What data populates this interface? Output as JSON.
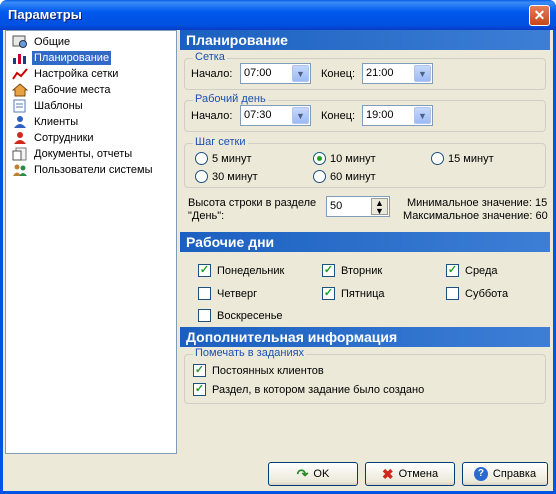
{
  "window": {
    "title": "Параметры",
    "close_glyph": "✕"
  },
  "tree": {
    "items": [
      {
        "label": "Общие",
        "icon": "general-icon"
      },
      {
        "label": "Планирование",
        "icon": "planning-icon",
        "selected": true
      },
      {
        "label": "Настройка сетки",
        "icon": "grid-settings-icon"
      },
      {
        "label": "Рабочие места",
        "icon": "workplaces-icon"
      },
      {
        "label": "Шаблоны",
        "icon": "templates-icon"
      },
      {
        "label": "Клиенты",
        "icon": "clients-icon"
      },
      {
        "label": "Сотрудники",
        "icon": "employees-icon"
      },
      {
        "label": "Документы, отчеты",
        "icon": "documents-icon"
      },
      {
        "label": "Пользователи системы",
        "icon": "users-icon"
      }
    ]
  },
  "planning": {
    "header": "Планирование",
    "grid": {
      "title": "Сетка",
      "start_label": "Начало:",
      "start_value": "07:00",
      "end_label": "Конец:",
      "end_value": "21:00"
    },
    "workday": {
      "title": "Рабочий день",
      "start_label": "Начало:",
      "start_value": "07:30",
      "end_label": "Конец:",
      "end_value": "19:00"
    },
    "step": {
      "title": "Шаг сетки",
      "options": [
        "5 минут",
        "10 минут",
        "15 минут",
        "30 минут",
        "60 минут"
      ],
      "selected": "10 минут"
    },
    "row_height": {
      "label_line1": "Высота строки в разделе",
      "label_line2": "\"День\":",
      "value": "50",
      "min_text": "Минимальное значение: 15",
      "max_text": "Максимальное значение: 60"
    }
  },
  "workdays": {
    "header": "Рабочие дни",
    "days": {
      "mon": {
        "label": "Понедельник",
        "checked": true
      },
      "tue": {
        "label": "Вторник",
        "checked": true
      },
      "wed": {
        "label": "Среда",
        "checked": true
      },
      "thu": {
        "label": "Четверг",
        "checked": false
      },
      "fri": {
        "label": "Пятница",
        "checked": true
      },
      "sat": {
        "label": "Суббота",
        "checked": false
      },
      "sun": {
        "label": "Воскресенье",
        "checked": false
      }
    }
  },
  "additional": {
    "header": "Дополнительная информация",
    "group_title": "Помечать в заданиях",
    "permanent_clients": {
      "label": "Постоянных клиентов",
      "checked": true
    },
    "section_created": {
      "label": "Раздел, в котором задание было создано",
      "checked": true
    }
  },
  "buttons": {
    "ok": "OK",
    "cancel": "Отмена",
    "help": "Справка"
  },
  "colors": {
    "title_bar": "#0054e3",
    "section_header": "#1b60c0",
    "selection": "#316ac5",
    "check": "#21a121"
  }
}
